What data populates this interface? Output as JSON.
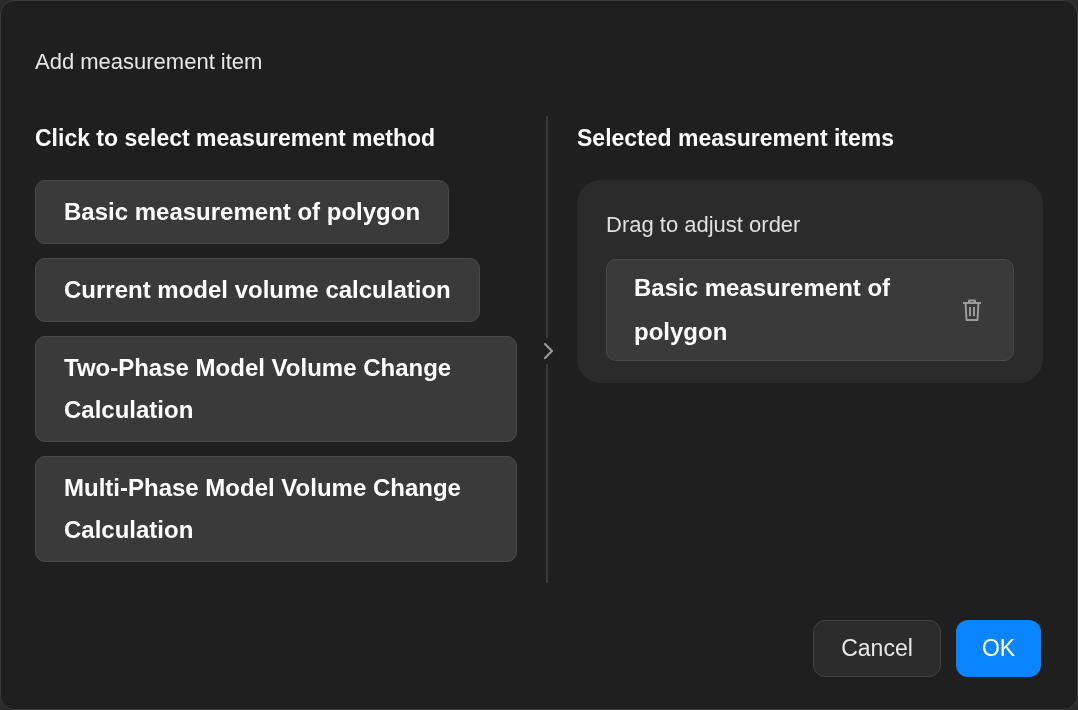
{
  "dialog": {
    "title": "Add measurement item"
  },
  "left": {
    "heading": "Click to select measurement method",
    "methods": [
      {
        "label": "Basic measurement of polygon"
      },
      {
        "label": "Current model volume calculation"
      },
      {
        "label": "Two-Phase Model Volume Change Calculation"
      },
      {
        "label": "Multi-Phase Model Volume Change Calculation"
      }
    ]
  },
  "right": {
    "heading": "Selected measurement items",
    "hint": "Drag to adjust order",
    "items": [
      {
        "label": "Basic measurement of polygon"
      }
    ]
  },
  "buttons": [
    {
      "label": "Cancel",
      "kind": "secondary"
    },
    {
      "label": "OK",
      "kind": "primary"
    }
  ]
}
